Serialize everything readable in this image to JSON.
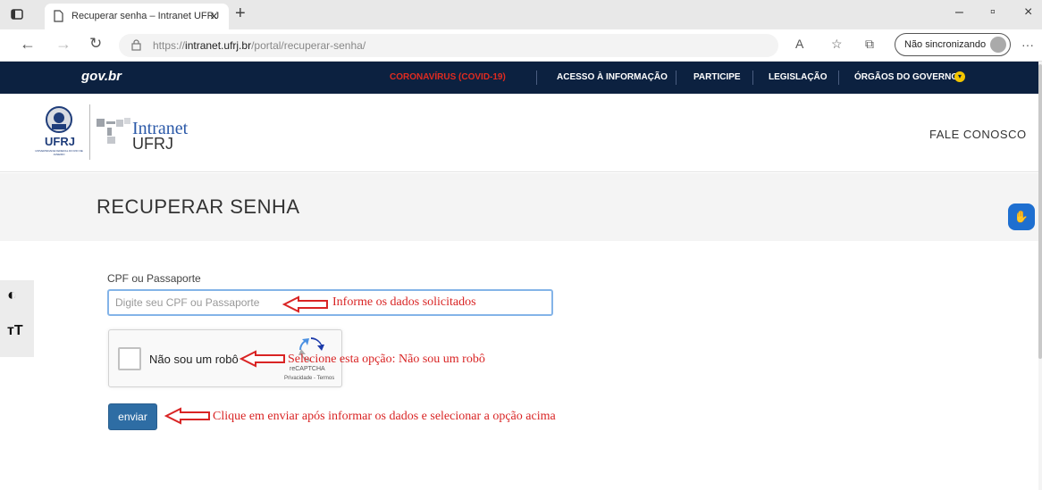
{
  "browser": {
    "tab_title": "Recuperar senha – Intranet UFRJ",
    "tab_close": "×",
    "new_tab": "+",
    "url_prefix": "https://",
    "url_host": "intranet.ufrj.br",
    "url_path": "/portal/recuperar-senha/",
    "sync_label": "Não sincronizando",
    "more": "···",
    "minimize": "–",
    "restore": "▫",
    "close": "×"
  },
  "govbar": {
    "logo": "gov.br",
    "links": [
      "CORONAVÍRUS (COVID-19)",
      "ACESSO À INFORMAÇÃO",
      "PARTICIPE",
      "LEGISLAÇÃO",
      "ÓRGÃOS DO GOVERNO"
    ],
    "covid_color": "#e02b20",
    "bg_color": "#0c2140"
  },
  "header": {
    "logo_caption": "UFRJ",
    "logo_sub": "UNIVERSIDADE FEDERAL DO RIO DE JANEIRO",
    "intranet_line1": "Intranet",
    "intranet_line2": "UFRJ",
    "fale_conosco": "FALE CONOSCO"
  },
  "page": {
    "title": "RECUPERAR SENHA"
  },
  "accessibility": {
    "contrast_icon": "◐",
    "font_icon": "тT"
  },
  "form": {
    "cpf_label": "CPF ou Passaporte",
    "cpf_placeholder": "Digite seu CPF ou Passaporte",
    "captcha_label": "Não sou um robô",
    "captcha_brand": "reCAPTCHA",
    "captcha_terms": "Privacidade - Termos",
    "submit_label": "enviar"
  },
  "annotations": {
    "note1": "Informe os dados solicitados",
    "note2": "Selecione esta opção: Não sou um robô",
    "note3": "Clique em enviar após informar os dados e selecionar a opção acima",
    "color": "#d92424"
  }
}
